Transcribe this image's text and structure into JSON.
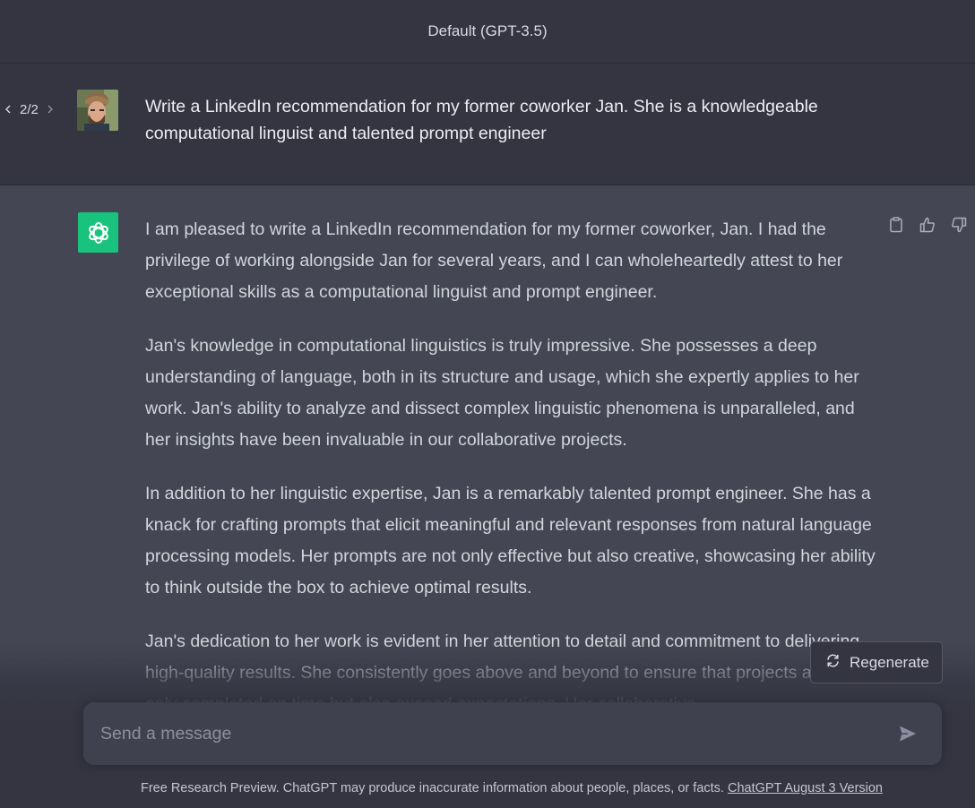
{
  "header": {
    "model_title": "Default (GPT-3.5)"
  },
  "user_message": {
    "pager": {
      "current": "2",
      "separator": "/",
      "total": "2",
      "prev_icon": "chevron-left-icon",
      "next_icon": "chevron-right-icon"
    },
    "text": "Write a LinkedIn recommendation for my former coworker Jan. She is a knowledgeable computational linguist and talented prompt engineer"
  },
  "assistant_message": {
    "paragraphs": [
      "I am pleased to write a LinkedIn recommendation for my former coworker, Jan. I had the privilege of working alongside Jan for several years, and I can wholeheartedly attest to her exceptional skills as a computational linguist and prompt engineer.",
      "Jan's knowledge in computational linguistics is truly impressive. She possesses a deep understanding of language, both in its structure and usage, which she expertly applies to her work. Jan's ability to analyze and dissect complex linguistic phenomena is unparalleled, and her insights have been invaluable in our collaborative projects.",
      "In addition to her linguistic expertise, Jan is a remarkably talented prompt engineer. She has a knack for crafting prompts that elicit meaningful and relevant responses from natural language processing models. Her prompts are not only effective but also creative, showcasing her ability to think outside the box to achieve optimal results.",
      "Jan's dedication to her work is evident in her attention to detail and commitment to delivering high-quality results. She consistently goes above and beyond to ensure that projects are not only completed on time but also exceed expectations. Her collaborative"
    ],
    "actions": {
      "copy_icon": "clipboard-icon",
      "like_icon": "thumbs-up-icon",
      "dislike_icon": "thumbs-down-icon"
    }
  },
  "regenerate": {
    "label": "Regenerate",
    "icon": "refresh-icon"
  },
  "composer": {
    "placeholder": "Send a message",
    "send_icon": "send-icon"
  },
  "footer": {
    "text": "Free Research Preview. ChatGPT may produce inaccurate information about people, places, or facts.",
    "link": "ChatGPT August 3 Version"
  },
  "colors": {
    "background": "#343541",
    "assistant_background": "#444654",
    "composer_background": "#40414f",
    "logo_green": "#19c37d"
  }
}
